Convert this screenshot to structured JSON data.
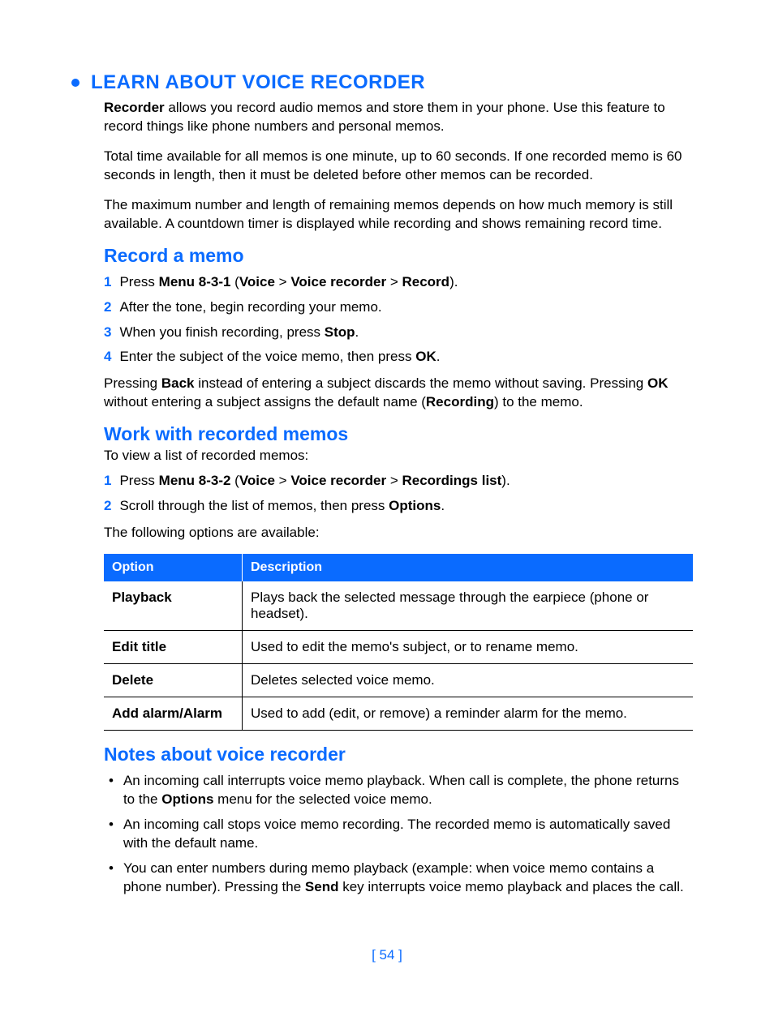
{
  "heading_main": "LEARN ABOUT VOICE RECORDER",
  "intro": {
    "p1_bold": "Recorder",
    "p1_rest": " allows you record audio memos and store them in your phone. Use this feature to record things like phone numbers and personal memos.",
    "p2": "Total time available for all memos is one minute, up to 60 seconds. If one recorded memo is 60 seconds in length, then it must be deleted before other memos can be recorded.",
    "p3": "The maximum number and length of remaining memos depends on how much memory is still available. A countdown timer is displayed while recording and shows remaining record time."
  },
  "record": {
    "heading": "Record a memo",
    "steps": {
      "s1_a": "Press ",
      "s1_b": "Menu 8-3-1",
      "s1_c": " (",
      "s1_d": "Voice",
      "s1_e": " > ",
      "s1_f": "Voice recorder",
      "s1_g": " > ",
      "s1_h": "Record",
      "s1_i": ").",
      "s2": "After the tone, begin recording your memo.",
      "s3_a": "When you finish recording, press ",
      "s3_b": "Stop",
      "s3_c": ".",
      "s4_a": "Enter the subject of the voice memo, then press ",
      "s4_b": "OK",
      "s4_c": "."
    },
    "after_a": "Pressing ",
    "after_b": "Back",
    "after_c": " instead of entering a subject discards the memo without saving. Pressing ",
    "after_d": "OK",
    "after_e": " without entering a subject assigns the default name (",
    "after_f": "Recording",
    "after_g": ") to the memo."
  },
  "work": {
    "heading": "Work with recorded memos",
    "intro": "To view a list of recorded memos:",
    "steps": {
      "s1_a": "Press ",
      "s1_b": "Menu 8-3-2",
      "s1_c": " (",
      "s1_d": "Voice",
      "s1_e": " > ",
      "s1_f": "Voice recorder",
      "s1_g": " > ",
      "s1_h": "Recordings list",
      "s1_i": ").",
      "s2_a": "Scroll through the list of memos, then press ",
      "s2_b": "Options",
      "s2_c": "."
    },
    "after": "The following options are available:",
    "table": {
      "col1": "Option",
      "col2": "Description",
      "rows": [
        {
          "opt": "Playback",
          "desc": "Plays back the selected message through the earpiece (phone or headset)."
        },
        {
          "opt": "Edit title",
          "desc": "Used to edit the memo's subject, or to rename memo."
        },
        {
          "opt": "Delete",
          "desc": "Deletes selected voice memo."
        },
        {
          "opt": "Add alarm/Alarm",
          "desc": "Used to add (edit, or remove) a reminder alarm for the memo."
        }
      ]
    }
  },
  "notes": {
    "heading": "Notes about voice recorder",
    "b1_a": "An incoming call interrupts voice memo playback. When call is complete, the phone returns to the ",
    "b1_b": "Options",
    "b1_c": " menu for the selected voice memo.",
    "b2": "An incoming call stops voice memo recording. The recorded memo is automatically saved with the default name.",
    "b3_a": "You can enter numbers during memo playback (example: when voice memo contains a phone number). Pressing the ",
    "b3_b": "Send",
    "b3_c": " key interrupts voice memo playback and places the call."
  },
  "page_number": "[ 54 ]"
}
